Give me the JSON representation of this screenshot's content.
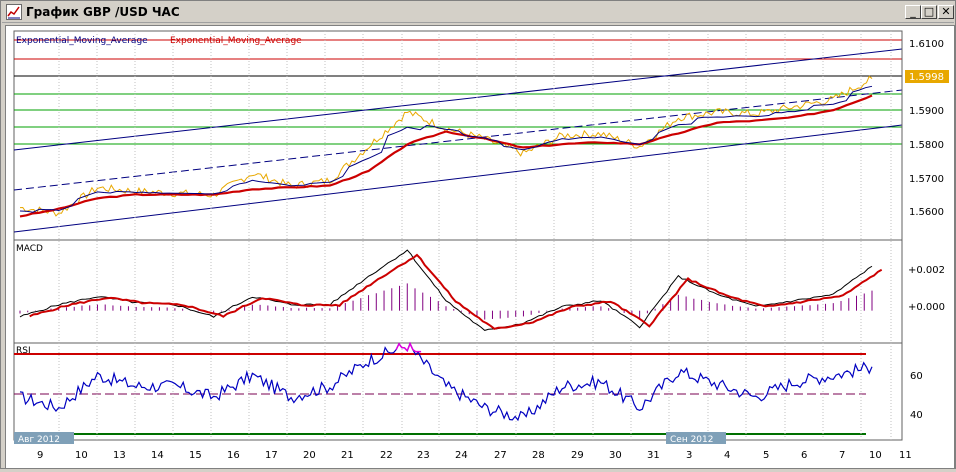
{
  "window": {
    "title": "График GBP /USD  ЧАС",
    "minimize_label": "_",
    "maximize_label": "□",
    "close_label": "✕"
  },
  "legend": {
    "ema_1": "Exponential_Moving_Average",
    "ema_2": "Exponential_Moving_Average",
    "ema_1_color": "#000080",
    "ema_2_color": "#cc0000"
  },
  "price_panel": {
    "price_ticks": [
      "1.6100",
      "1.6000",
      "1.5900",
      "1.5800",
      "1.5700",
      "1.5600"
    ],
    "current_price": "1.5998",
    "price_color": "#e8a800"
  },
  "macd_panel": {
    "label": "MACD",
    "ticks": [
      "+0.002",
      "+0.000"
    ]
  },
  "rsi_panel": {
    "label": "RSI",
    "ticks": [
      "60",
      "40"
    ]
  },
  "time_axis": {
    "month_aug": "Авг 2012",
    "month_sep": "Сен 2012",
    "day_labels": [
      "9",
      "10",
      "13",
      "14",
      "15",
      "16",
      "17",
      "20",
      "21",
      "22",
      "23",
      "24",
      "27",
      "28",
      "29",
      "30",
      "31",
      "3",
      "4",
      "5",
      "6",
      "7",
      "10",
      "11"
    ]
  },
  "chart_data": [
    {
      "type": "line",
      "title": "GBP /USD",
      "x": [
        "9",
        "10",
        "13",
        "14",
        "15",
        "16",
        "17",
        "20",
        "21",
        "22",
        "23",
        "24",
        "27",
        "28",
        "29",
        "30",
        "31",
        "3",
        "4",
        "5",
        "6",
        "7",
        "10"
      ],
      "series": [
        {
          "name": "",
          "values": [
            1.564,
            1.5625,
            1.5695,
            1.5685,
            1.568,
            1.5675,
            1.5735,
            1.57,
            1.5715,
            1.581,
            1.5905,
            1.586,
            1.583,
            1.579,
            1.584,
            1.5845,
            1.581,
            1.589,
            1.5905,
            1.59,
            1.592,
            1.594,
            1.5998
          ]
        },
        {
          "name": "Exponential_Moving_Average",
          "values": [
            1.562,
            1.564,
            1.567,
            1.568,
            1.568,
            1.568,
            1.5695,
            1.57,
            1.5705,
            1.5745,
            1.582,
            1.5855,
            1.5835,
            1.581,
            1.582,
            1.5825,
            1.582,
            1.585,
            1.588,
            1.5885,
            1.5895,
            1.5915,
            1.5955
          ]
        }
      ],
      "ylim": [
        1.555,
        1.613
      ]
    },
    {
      "type": "line",
      "title": "MACD",
      "x": [
        "9",
        "10",
        "13",
        "14",
        "15",
        "16",
        "17",
        "20",
        "21",
        "22",
        "23",
        "24",
        "27",
        "28",
        "29",
        "30",
        "31",
        "3",
        "4",
        "5",
        "6",
        "7",
        "10"
      ],
      "series": [
        {
          "name": "",
          "values": [
            -0.0003,
            0.0003,
            0.0007,
            0.0004,
            0.0003,
            -0.0003,
            0.0007,
            0.0003,
            0.0003,
            0.0017,
            0.003,
            0.0005,
            -0.001,
            -0.0006,
            0.0002,
            0.0005,
            -0.0008,
            0.0017,
            0.0008,
            0.0002,
            0.0005,
            0.0008,
            0.0022
          ]
        }
      ],
      "ylim": [
        -0.0017,
        0.0035
      ]
    },
    {
      "type": "line",
      "title": "RSI",
      "x": [
        "9",
        "10",
        "13",
        "14",
        "15",
        "16",
        "17",
        "20",
        "21",
        "22",
        "23",
        "24",
        "27",
        "28",
        "29",
        "30",
        "31",
        "3",
        "4",
        "5",
        "6",
        "7",
        "10"
      ],
      "series": [
        {
          "name": "",
          "values": [
            50,
            45,
            60,
            55,
            55,
            50,
            60,
            50,
            55,
            67,
            74,
            55,
            45,
            40,
            55,
            57,
            45,
            62,
            56,
            50,
            57,
            60,
            64
          ]
        }
      ],
      "ylim": [
        30,
        75
      ]
    }
  ]
}
